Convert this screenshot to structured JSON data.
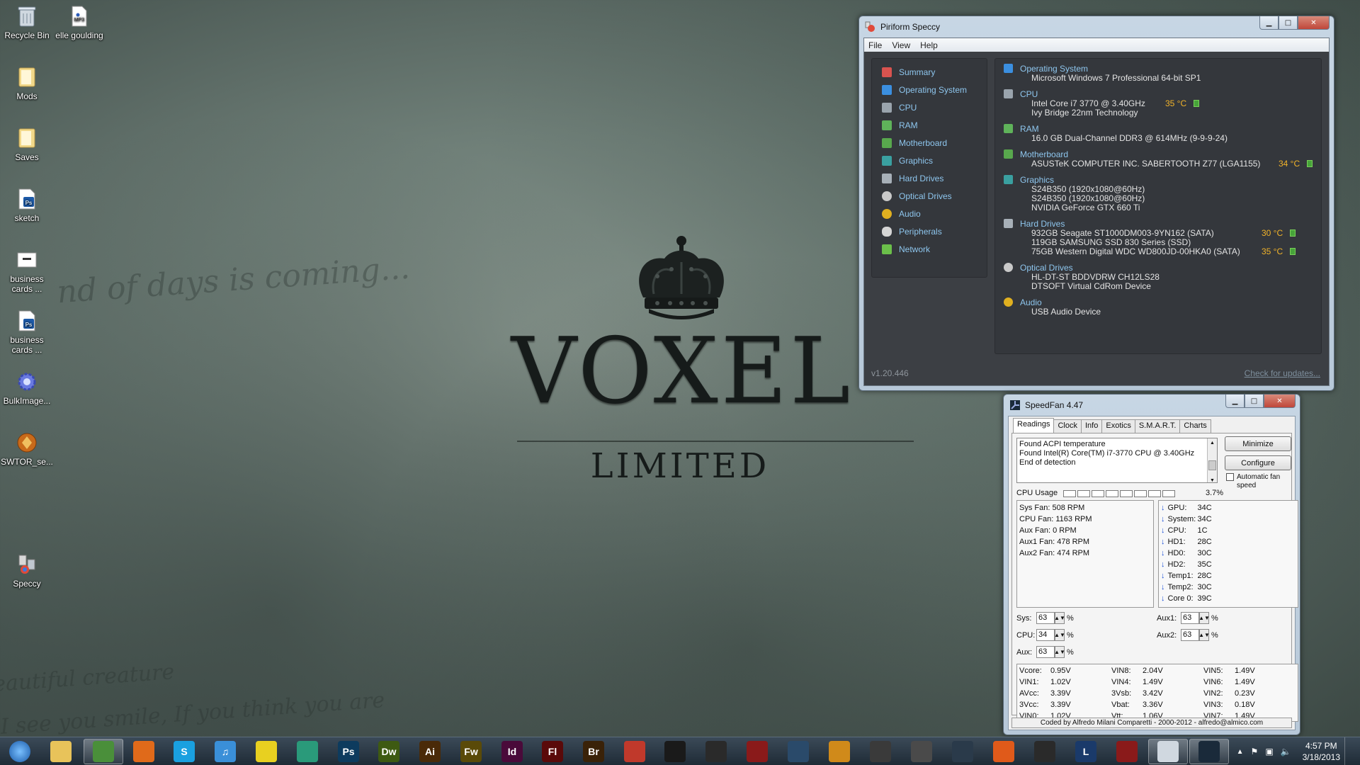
{
  "desktop": {
    "icons": [
      {
        "label": "Recycle Bin",
        "icon": "recycle-bin-icon"
      },
      {
        "label": "elle goulding",
        "icon": "mp3-file-icon"
      },
      {
        "label": "Mods",
        "icon": "folder-icon"
      },
      {
        "label": "Saves",
        "icon": "folder-icon"
      },
      {
        "label": "sketch",
        "icon": "psd-file-icon"
      },
      {
        "label": "business cards ...",
        "icon": "document-icon"
      },
      {
        "label": "business cards ...",
        "icon": "psd-file-icon"
      },
      {
        "label": "BulkImage...",
        "icon": "gear-icon"
      },
      {
        "label": "SWTOR_se...",
        "icon": "swtor-icon"
      },
      {
        "label": "Speccy",
        "icon": "speccy-icon"
      }
    ],
    "wallpaper": {
      "brand": "VOXEL",
      "sub": "LIMITED",
      "script_top": "nd of days is coming...",
      "script_bottom1": "eautiful creature",
      "script_bottom2": "I see you smile, If you think you are"
    }
  },
  "speccy": {
    "title": "Piriform Speccy",
    "menu": [
      "File",
      "View",
      "Help"
    ],
    "sidebar": [
      {
        "label": "Summary",
        "color": "#d9534f"
      },
      {
        "label": "Operating System",
        "color": "#3b8fe0"
      },
      {
        "label": "CPU",
        "color": "#9aa4ad"
      },
      {
        "label": "RAM",
        "color": "#5fb35a"
      },
      {
        "label": "Motherboard",
        "color": "#58a84d"
      },
      {
        "label": "Graphics",
        "color": "#3aa0a0"
      },
      {
        "label": "Hard Drives",
        "color": "#a7b0b8"
      },
      {
        "label": "Optical Drives",
        "color": "#c9c9c9"
      },
      {
        "label": "Audio",
        "color": "#e0b020"
      },
      {
        "label": "Peripherals",
        "color": "#d5d5d5"
      },
      {
        "label": "Network",
        "color": "#6bbf4a"
      }
    ],
    "sections": {
      "os": {
        "title": "Operating System",
        "line1": "Microsoft Windows 7 Professional 64-bit SP1"
      },
      "cpu": {
        "title": "CPU",
        "line1": "Intel Core i7 3770 @ 3.40GHz",
        "temp": "35 °C",
        "line2": "Ivy Bridge 22nm Technology"
      },
      "ram": {
        "title": "RAM",
        "line1": "16.0 GB Dual-Channel DDR3 @ 614MHz (9-9-9-24)"
      },
      "mb": {
        "title": "Motherboard",
        "line1": "ASUSTeK COMPUTER INC. SABERTOOTH Z77 (LGA1155)",
        "temp": "34 °C"
      },
      "gfx": {
        "title": "Graphics",
        "line1": "S24B350 (1920x1080@60Hz)",
        "line2": "S24B350 (1920x1080@60Hz)",
        "line3": "NVIDIA GeForce GTX 660 Ti"
      },
      "hdd": {
        "title": "Hard Drives",
        "line1": "932GB Seagate ST1000DM003-9YN162 (SATA)",
        "temp1": "30 °C",
        "line2": "119GB SAMSUNG SSD 830 Series (SSD)",
        "line3": "75GB Western Digital WDC WD800JD-00HKA0 (SATA)",
        "temp3": "35 °C"
      },
      "odd": {
        "title": "Optical Drives",
        "line1": "HL-DT-ST BDDVDRW CH12LS28",
        "line2": "DTSOFT Virtual CdRom Device"
      },
      "audio": {
        "title": "Audio",
        "line1": "USB Audio Device"
      }
    },
    "version": "v1.20.446",
    "update_link": "Check for updates..."
  },
  "speedfan": {
    "title": "SpeedFan 4.47",
    "tabs": [
      "Readings",
      "Clock",
      "Info",
      "Exotics",
      "S.M.A.R.T.",
      "Charts"
    ],
    "log": [
      "Found ACPI temperature",
      "Found Intel(R) Core(TM) i7-3770 CPU @ 3.40GHz",
      "End of detection"
    ],
    "minimize_label": "Minimize",
    "configure_label": "Configure",
    "auto_fan_label": "Automatic fan speed",
    "cpu_usage_label": "CPU Usage",
    "cpu_usage_value": "3.7%",
    "fans": [
      {
        "name": "Sys Fan:",
        "value": "508 RPM"
      },
      {
        "name": "CPU Fan:",
        "value": "1163 RPM"
      },
      {
        "name": "Aux Fan:",
        "value": "0 RPM"
      },
      {
        "name": "Aux1 Fan:",
        "value": "478 RPM"
      },
      {
        "name": "Aux2 Fan:",
        "value": "474 RPM"
      }
    ],
    "temps": [
      {
        "name": "GPU:",
        "value": "34C"
      },
      {
        "name": "System:",
        "value": "34C"
      },
      {
        "name": "CPU:",
        "value": "1C"
      },
      {
        "name": "HD1:",
        "value": "28C"
      },
      {
        "name": "HD0:",
        "value": "30C"
      },
      {
        "name": "HD2:",
        "value": "35C"
      },
      {
        "name": "Temp1:",
        "value": "28C"
      },
      {
        "name": "Temp2:",
        "value": "30C"
      },
      {
        "name": "Core 0:",
        "value": "39C"
      }
    ],
    "speeds": {
      "sys": {
        "label": "Sys:",
        "value": "63"
      },
      "cpu": {
        "label": "CPU:",
        "value": "34"
      },
      "aux": {
        "label": "Aux:",
        "value": "63"
      },
      "aux1": {
        "label": "Aux1:",
        "value": "63"
      },
      "aux2": {
        "label": "Aux2:",
        "value": "63"
      },
      "unit": "%"
    },
    "voltages": [
      [
        {
          "n": "Vcore:",
          "v": "0.95V"
        },
        {
          "n": "VIN1:",
          "v": "1.02V"
        },
        {
          "n": "AVcc:",
          "v": "3.39V"
        },
        {
          "n": "3Vcc:",
          "v": "3.39V"
        },
        {
          "n": "VIN0:",
          "v": "1.02V"
        }
      ],
      [
        {
          "n": "VIN8:",
          "v": "2.04V"
        },
        {
          "n": "VIN4:",
          "v": "1.49V"
        },
        {
          "n": "3Vsb:",
          "v": "3.42V"
        },
        {
          "n": "Vbat:",
          "v": "3.36V"
        },
        {
          "n": "Vtt:",
          "v": "1.06V"
        }
      ],
      [
        {
          "n": "VIN5:",
          "v": "1.49V"
        },
        {
          "n": "VIN6:",
          "v": "1.49V"
        },
        {
          "n": "VIN2:",
          "v": "0.23V"
        },
        {
          "n": "VIN3:",
          "v": "0.18V"
        },
        {
          "n": "VIN7:",
          "v": "1.49V"
        }
      ]
    ],
    "footer": "Coded by Alfredo Milani Comparetti - 2000-2012 - alfredo@almico.com"
  },
  "taskbar": {
    "apps": [
      {
        "name": "start-orb",
        "glyph": "",
        "color": "#2a7ac8"
      },
      {
        "name": "explorer",
        "glyph": "",
        "color": "#e8c35a"
      },
      {
        "name": "chrome",
        "glyph": "",
        "color": "#4a8f3a"
      },
      {
        "name": "firefox",
        "glyph": "",
        "color": "#e06a1a"
      },
      {
        "name": "skype",
        "glyph": "S",
        "color": "#1aa0e0"
      },
      {
        "name": "itunes",
        "glyph": "♫",
        "color": "#3a8fd8"
      },
      {
        "name": "norton",
        "glyph": "",
        "color": "#e8d020"
      },
      {
        "name": "app-green",
        "glyph": "",
        "color": "#2a9a7a"
      },
      {
        "name": "photoshop",
        "glyph": "Ps",
        "color": "#0d3b5e"
      },
      {
        "name": "dreamweaver",
        "glyph": "Dw",
        "color": "#3e5a12"
      },
      {
        "name": "illustrator",
        "glyph": "Ai",
        "color": "#4a2a08"
      },
      {
        "name": "fireworks",
        "glyph": "Fw",
        "color": "#5a4a08"
      },
      {
        "name": "indesign",
        "glyph": "Id",
        "color": "#4a0a3a"
      },
      {
        "name": "flash",
        "glyph": "Fl",
        "color": "#5a0a0a"
      },
      {
        "name": "bridge",
        "glyph": "Br",
        "color": "#3a2208"
      },
      {
        "name": "app-red",
        "glyph": "",
        "color": "#c0392b"
      },
      {
        "name": "app-live",
        "glyph": "",
        "color": "#1a1a1a"
      },
      {
        "name": "app-circle",
        "glyph": "",
        "color": "#2a2a2a"
      },
      {
        "name": "app-target",
        "glyph": "",
        "color": "#8a1a1a"
      },
      {
        "name": "app-origin",
        "glyph": "",
        "color": "#2a4a6a"
      },
      {
        "name": "app-orange",
        "glyph": "",
        "color": "#d08a1a"
      },
      {
        "name": "app-steam-like",
        "glyph": "",
        "color": "#3a3a3a"
      },
      {
        "name": "app-logmein",
        "glyph": "",
        "color": "#4a4a4a"
      },
      {
        "name": "steam",
        "glyph": "",
        "color": "#2a3a4a"
      },
      {
        "name": "app-orange2",
        "glyph": "",
        "color": "#e05a1a"
      },
      {
        "name": "app-pirate",
        "glyph": "",
        "color": "#2a2a2a"
      },
      {
        "name": "league",
        "glyph": "L",
        "color": "#1a3a6a"
      },
      {
        "name": "app-redtri",
        "glyph": "",
        "color": "#8a1a1a"
      },
      {
        "name": "speccy",
        "glyph": "",
        "color": "#d0d8e0"
      },
      {
        "name": "speedfan",
        "glyph": "",
        "color": "#1a2a3a"
      }
    ],
    "time": "4:57 PM",
    "date": "3/18/2013"
  }
}
